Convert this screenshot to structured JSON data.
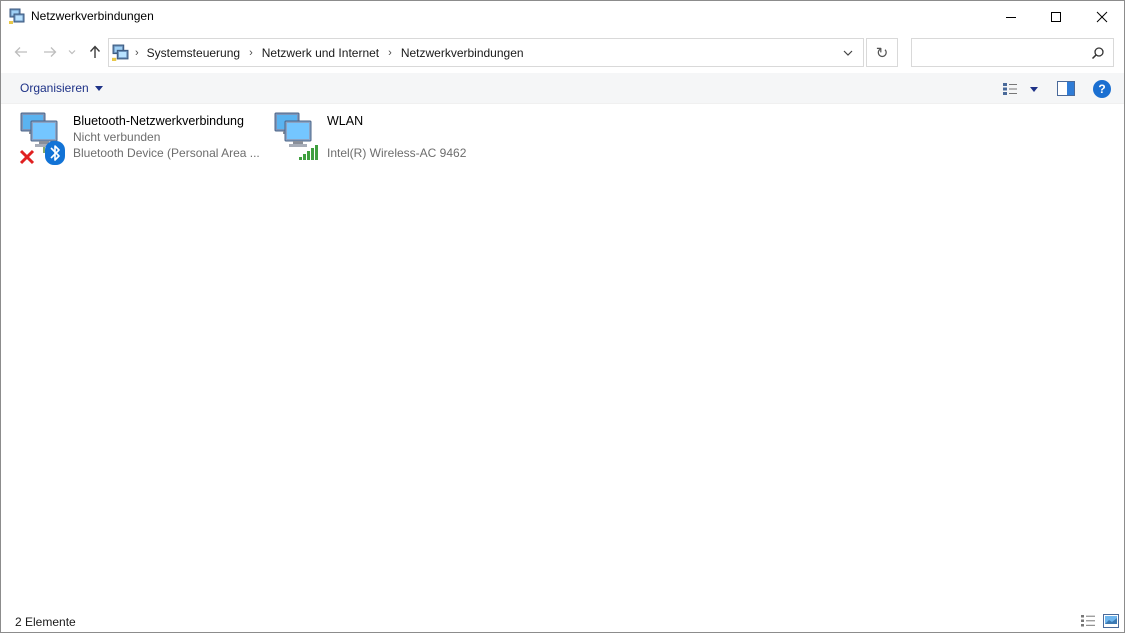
{
  "window": {
    "title": "Netzwerkverbindungen",
    "icon": "network-connections-icon",
    "controls": [
      "minimize-icon",
      "maximize-icon",
      "close-icon"
    ]
  },
  "address": {
    "breadcrumbs": [
      "Systemsteuerung",
      "Netzwerk und Internet",
      "Netzwerkverbindungen"
    ],
    "refresh_glyph": "↻"
  },
  "search": {
    "placeholder": "",
    "value": ""
  },
  "toolbar": {
    "organize_label": "Organisieren",
    "help_glyph": "?"
  },
  "connections": [
    {
      "name": "Bluetooth-Netzwerkverbindung",
      "status": "Nicht verbunden",
      "device": "Bluetooth Device (Personal Area ...",
      "icon": "network-adapter-icon",
      "overlay": "disconnected-x-icon",
      "badge": "bluetooth-icon"
    },
    {
      "name": "WLAN",
      "status": "",
      "device": "Intel(R) Wireless-AC 9462",
      "icon": "network-adapter-icon",
      "overlay": "wifi-signal-icon"
    }
  ],
  "statusbar": {
    "count": "2 Elemente"
  },
  "colors": {
    "command_text": "#1e3287",
    "help_blue": "#1a6fd1",
    "bluetooth_blue": "#1273d6",
    "signal_green": "#3f9f3f",
    "error_red": "#e02020"
  }
}
